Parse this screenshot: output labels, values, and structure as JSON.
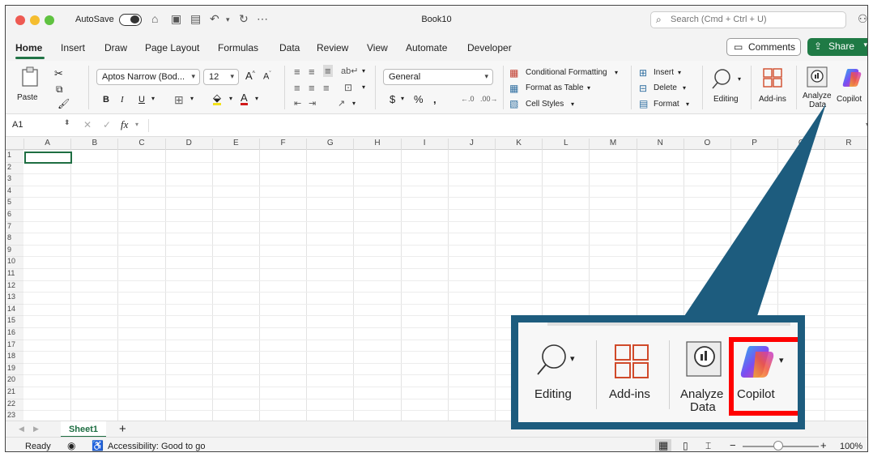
{
  "titlebar": {
    "autosave_label": "AutoSave",
    "title": "Book10",
    "search_placeholder": "Search (Cmd + Ctrl + U)"
  },
  "tabs": [
    {
      "label": "Home",
      "active": true
    },
    {
      "label": "Insert"
    },
    {
      "label": "Draw"
    },
    {
      "label": "Page Layout"
    },
    {
      "label": "Formulas"
    },
    {
      "label": "Data"
    },
    {
      "label": "Review"
    },
    {
      "label": "View"
    },
    {
      "label": "Automate"
    },
    {
      "label": "Developer"
    }
  ],
  "actions": {
    "comments": "Comments",
    "share": "Share"
  },
  "ribbon": {
    "paste": "Paste",
    "font_name": "Aptos Narrow (Bod...",
    "font_size": "12",
    "bold": "B",
    "italic": "I",
    "underline": "U",
    "number_format": "General",
    "conditional_formatting": "Conditional Formatting",
    "format_as_table": "Format as Table",
    "cell_styles": "Cell Styles",
    "insert": "Insert",
    "delete": "Delete",
    "format": "Format",
    "editing": "Editing",
    "addins": "Add-ins",
    "analyze_data_1": "Analyze",
    "analyze_data_2": "Data",
    "copilot": "Copilot"
  },
  "formula_bar": {
    "name_box": "A1",
    "fx": "fx"
  },
  "columns": [
    "A",
    "B",
    "C",
    "D",
    "E",
    "F",
    "G",
    "H",
    "I",
    "J",
    "K",
    "L",
    "M",
    "N",
    "O",
    "P",
    "Q",
    "R"
  ],
  "rows": [
    "1",
    "2",
    "3",
    "4",
    "5",
    "6",
    "7",
    "8",
    "9",
    "10",
    "11",
    "12",
    "13",
    "14",
    "15",
    "16",
    "17",
    "18",
    "19",
    "20",
    "21",
    "22",
    "23"
  ],
  "sheets": {
    "active": "Sheet1",
    "add": "+"
  },
  "status": {
    "ready": "Ready",
    "accessibility": "Accessibility: Good to go",
    "zoom": "100%"
  },
  "callout": {
    "editing": "Editing",
    "addins": "Add-ins",
    "analyze_1": "Analyze",
    "analyze_2": "Data",
    "copilot": "Copilot"
  },
  "colors": {
    "accent_green": "#1f7a45",
    "callout_blue": "#1d5c7e",
    "highlight_red": "#ff0000"
  }
}
